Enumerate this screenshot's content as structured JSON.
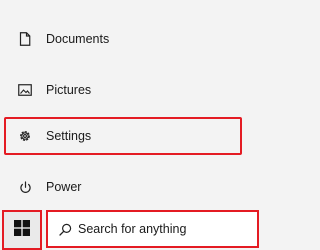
{
  "start_menu": {
    "items": [
      {
        "label": "Documents",
        "icon": "document-icon"
      },
      {
        "label": "Pictures",
        "icon": "picture-icon"
      },
      {
        "label": "Settings",
        "icon": "gear-icon",
        "highlighted": true
      },
      {
        "label": "Power",
        "icon": "power-icon"
      }
    ]
  },
  "taskbar": {
    "start_icon": "windows-logo-icon",
    "search": {
      "placeholder": "Search for anything",
      "value": "",
      "icon": "search-icon"
    }
  },
  "colors": {
    "highlight": "#e41b23",
    "background": "#f3f3f3",
    "text": "#1a1a1a"
  }
}
